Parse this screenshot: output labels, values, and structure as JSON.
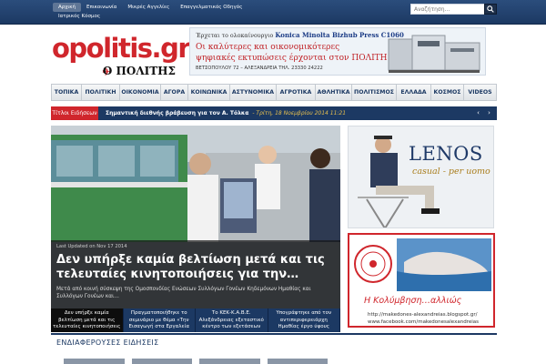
{
  "topbar": {
    "nav": [
      "Αρχική",
      "Επικοινωνία",
      "Μικρές Αγγελίες",
      "Επαγγελματικός Οδηγός",
      "Ιατρικός Κόσμος"
    ],
    "search_placeholder": "Αναζήτηση..."
  },
  "logo": {
    "main": "opolitis.gr",
    "sub": "Ο ΠΟΛΙΤΗΣ"
  },
  "header_ad": {
    "line1_prefix": "Έρχεται το ολοκαίνουργιο",
    "line1_brand": "Konica Minolta Bizhub Press C1060",
    "line2": "Οι καλύτερες  και οικονομικότερες",
    "line3": "ψηφιακές εκτυπώσεις έρχονται στον ΠΟΛΙΤΗ",
    "address": "ΒΕΤΣΟΠΟΥΛΟΥ 72 – ΑΛΕΞΑΝΔΡΕΙΑ  ΤΗΛ. 23330 24222"
  },
  "mainnav": [
    "ΤΟΠΙΚΑ",
    "ΠΟΛΙΤΙΚΗ",
    "ΟΙΚΟΝΟΜΙΑ",
    "ΑΓΟΡΑ",
    "ΚΟΙΝΩΝΙΚΑ",
    "ΑΣΤΥΝΟΜΙΚΑ",
    "ΑΓΡΟΤΙΚΑ",
    "ΑΘΛΗΤΙΚΑ",
    "ΠΟΛΙΤΙΣΜΟΣ",
    "ΕΛΛΑΔΑ",
    "ΚΟΣΜΟΣ",
    "VIDEOS"
  ],
  "ticker": {
    "label": "Τίτλοι Ειδήσεων",
    "text": "Σημαντική διεθνής βράβευση για τον Α. Τόλκα",
    "date": "- Τρίτη, 18 Νοεμβρίου 2014 11:21"
  },
  "slide": {
    "date": "Last Updated on Nov 17 2014",
    "title": "Δεν υπήρξε καμία βελτίωση μετά και τις τελευταίες κινητοποιήσεις για την…",
    "excerpt": "Μετά από κοινή σύσκεψη της Ομοσπονδίας Ενώσεων Συλλόγων Γονέων Κηδεμόνων Ημαθίας και Συλλόγων Γονέων και…"
  },
  "thumbs": [
    "Δεν υπήρξε καμία βελτίωση μετά και τις τελευταίες κινητοποιήσεις",
    "Πραγματοποιήθηκε το σεμινάριο με θέμα «Την Εισαγωγή στα Εργαλεία",
    "Το ΚΕΚ-Κ.Α.Β.Ε. Αλεξάνδρειας εξεταστικό κέντρο των εξετάσεων του",
    "Υπογράφτηκε από τον αντιπεριφερειάρχη Ημαθίας έργο ύψους"
  ],
  "ad_lenos": {
    "name": "LENOS",
    "tag": "casual - per uomo"
  },
  "ad_swim": {
    "title": "Η Κολύμβηση…αλλιώς",
    "url1": "http://makedones-alexandreias.blogspot.gr/",
    "url2": "www.facebook.com/makedonesalexandreias"
  },
  "section": {
    "title": "ΕΝΔΙΑΦΕΡΟΥΣΕΣ ΕΙΔΗΣΕΙΣ"
  },
  "colors": {
    "brand_red": "#d0262c",
    "navy": "#1c3963"
  }
}
